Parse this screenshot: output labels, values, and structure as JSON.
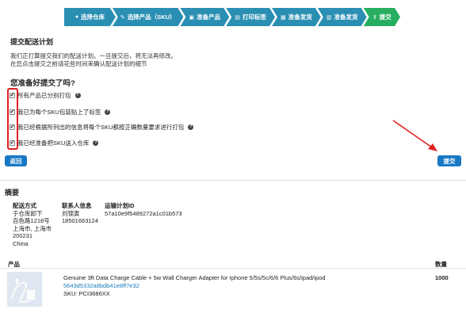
{
  "steps": [
    {
      "label": "选择仓库",
      "icon": "check-icon",
      "active": false
    },
    {
      "label": "选择产品（SKU）",
      "icon": "tag-icon",
      "active": false
    },
    {
      "label": "准备产品",
      "icon": "edit-icon",
      "active": false
    },
    {
      "label": "打印标签",
      "icon": "print-icon",
      "active": false
    },
    {
      "label": "准备发货",
      "icon": "box-icon",
      "active": false
    },
    {
      "label": "准备发货",
      "icon": "truck-icon",
      "active": false
    },
    {
      "label": "提交",
      "icon": "upload-icon",
      "active": true
    }
  ],
  "page": {
    "title": "提交配送计划",
    "intro_line1": "我们正打算提交我们的配送计划。一旦提交后，将无法再修改。",
    "intro_line2": "在您点击提交之前请花些时间来确认配送计划的细节",
    "question": "您准备好提交了吗?"
  },
  "checklist": [
    {
      "label": "所有产品已分别打包",
      "checked": true
    },
    {
      "label": "我已为每个SKU包装贴上了标签",
      "checked": true
    },
    {
      "label": "我已经根据所列出的信息将每个SKU都按正确数量要求进行打包",
      "checked": true
    },
    {
      "label": "我已经准备把SKU送入仓库",
      "checked": true
    }
  ],
  "buttons": {
    "back": "返回",
    "submit": "提交"
  },
  "summary": {
    "title": "摘要",
    "shipping": {
      "header": "配送方式",
      "lines": [
        "于仓库卸下",
        "百色路1218号",
        "上海市, 上海市",
        "200231",
        "China"
      ]
    },
    "contact": {
      "header": "联系人信息",
      "lines": [
        "刘锦寅",
        "18501663124"
      ]
    },
    "plan": {
      "header": "运输计划ID",
      "id": "57a10e9f5489272a1c01b573"
    }
  },
  "products": {
    "col_product": "产品",
    "col_qty": "数量",
    "items": [
      {
        "name": "Genuine 3ft Data Charge Cable + 5w Wall Charger Adapter for Iphone 5/5s/5c/6/6 Plus/6s/ipad/ipod",
        "id": "5643d5332a8bdb41e8ff7e32",
        "sku": "SKU: PCI3686XX",
        "qty": "1000"
      }
    ]
  },
  "colors": {
    "step": "#2a8fb3",
    "step_active": "#27ae60",
    "button": "#1878c4",
    "highlight": "#e02020",
    "link": "#1a7bbd"
  }
}
